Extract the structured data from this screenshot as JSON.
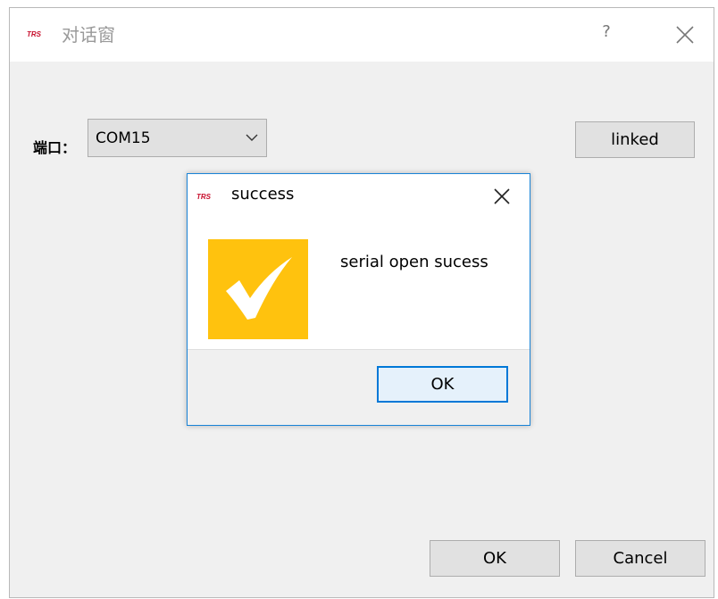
{
  "main_window": {
    "logo_text": "TRS",
    "title": "对话窗",
    "help_label": "?",
    "port_label": "端口：",
    "port_value": "COM15",
    "linked_label": "linked",
    "ok_label": "OK",
    "cancel_label": "Cancel"
  },
  "message_box": {
    "logo_text": "TRS",
    "title": "success",
    "message": "serial open sucess",
    "ok_label": "OK",
    "icon": "checkmark-icon",
    "icon_bg": "#ffc20e",
    "accent": "#0078d7"
  }
}
